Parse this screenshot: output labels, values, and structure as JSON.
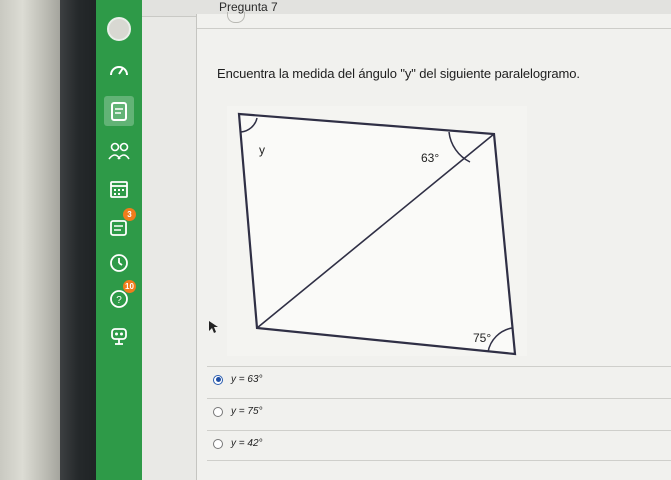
{
  "page": {
    "title": "Pregunta 7"
  },
  "sidebar": {
    "badges": {
      "notifications": "3",
      "help": "10"
    }
  },
  "question": {
    "text": "Encuentra la medida del ángulo \"y\" del siguiente paralelogramo.",
    "figure": {
      "label_y": "y",
      "label_top_right": "63°",
      "label_bottom_right": "75°"
    },
    "options": [
      {
        "label": "y = 63°",
        "selected": true
      },
      {
        "label": "y = 75°",
        "selected": false
      },
      {
        "label": "y = 42°",
        "selected": false
      }
    ]
  },
  "colors": {
    "sidebar": "#2e9a48",
    "radio_selected": "#1f4fa5",
    "badge": "#f07c1c"
  }
}
